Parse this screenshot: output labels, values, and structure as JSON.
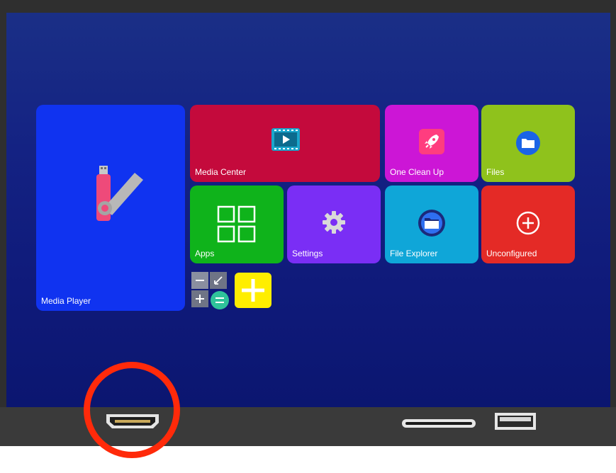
{
  "tiles": {
    "media_player": {
      "label": "Media Player",
      "color": "#1033f0"
    },
    "media_center": {
      "label": "Media Center",
      "color": "#c40a3c"
    },
    "one_clean_up": {
      "label": "One Clean Up",
      "color": "#cc16d6"
    },
    "files": {
      "label": "Files",
      "color": "#8fc21c"
    },
    "apps": {
      "label": "Apps",
      "color": "#0fb31b"
    },
    "settings": {
      "label": "Settings",
      "color": "#7a2ef5"
    },
    "file_explorer": {
      "label": "File Explorer",
      "color": "#0fa6d8"
    },
    "unconfigured": {
      "label": "Unconfigured",
      "color": "#e42a26"
    }
  },
  "small_icons": [
    "calculator-icon",
    "add-icon"
  ],
  "ports": [
    "hdmi-port",
    "sd-card-slot",
    "usb-port"
  ],
  "highlight_color": "#ff2a0a"
}
